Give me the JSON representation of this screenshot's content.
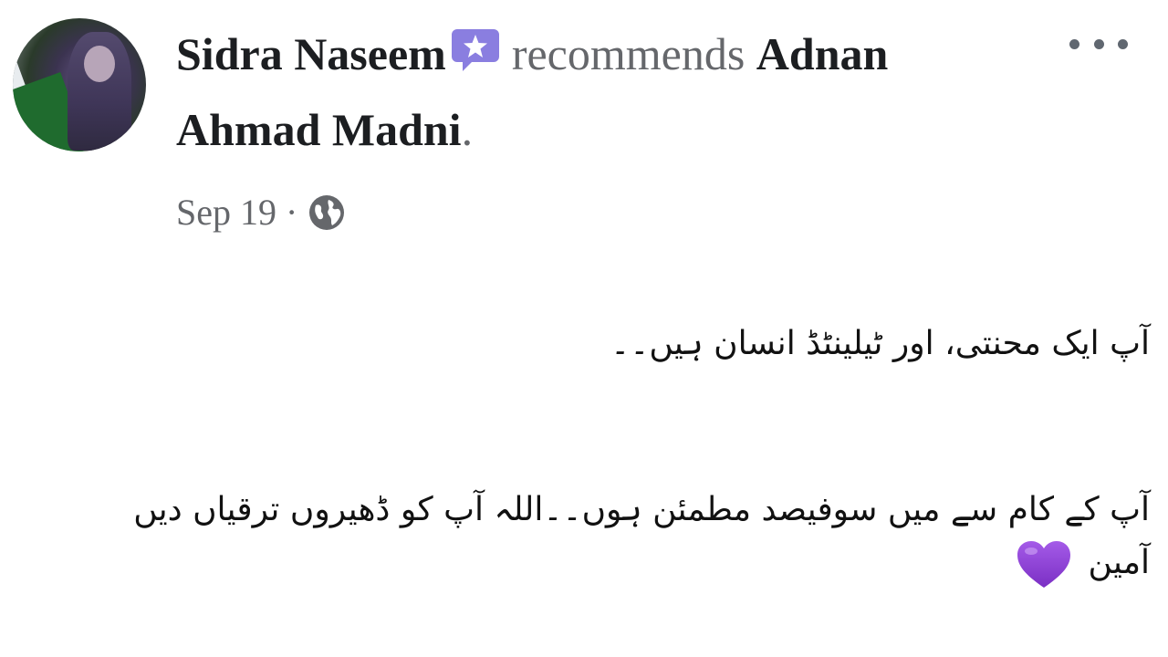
{
  "author": {
    "name": "Sidra Naseem",
    "badge_icon": "star-badge-icon"
  },
  "action": {
    "verb": "recommends",
    "target_part1": "Adnan",
    "target_part2": "Ahmad Madni",
    "punctuation": "."
  },
  "meta": {
    "date": "Sep 19",
    "separator": "·",
    "privacy_icon": "globe-icon"
  },
  "menu": {
    "icon": "more-options-icon"
  },
  "body": {
    "paragraph1": "آپ ایک محنتی، اور ٹیلینٹڈ انسان ہیں۔۔",
    "paragraph2_line1": "آپ کے کام سے میں سوفیصد مطمئن ہوں۔۔اللہ آپ کو ڈھیروں ترقیاں دیں",
    "paragraph2_line2": "آمین",
    "emoji": "purple-heart-icon"
  },
  "colors": {
    "text": "#1c1e21",
    "muted": "#65676b",
    "badge": "#8a7ee0",
    "heart": "#8e44d6"
  }
}
